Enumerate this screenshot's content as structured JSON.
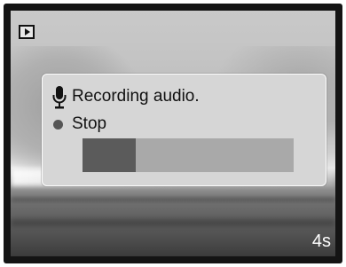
{
  "playback_indicator": {
    "icon": "playback-mode-icon"
  },
  "recording_dialog": {
    "icon": "microphone-icon",
    "title": "Recording audio.",
    "stop_label": "Stop",
    "progress": 0.25
  },
  "timer": {
    "text": "4s"
  },
  "colors": {
    "dialog_background": "#d6d6d6",
    "progress_track": "#a9a9a9",
    "progress_fill": "#5b5b5b",
    "timer_text": "#ffffff"
  }
}
